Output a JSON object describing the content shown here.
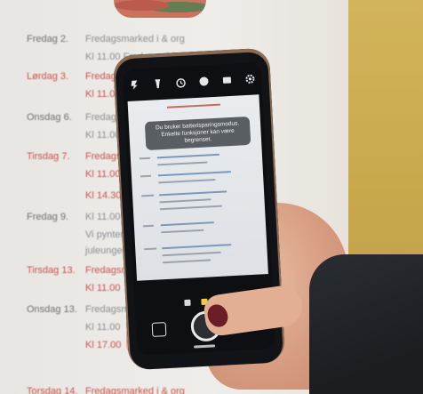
{
  "background_document": {
    "rows": [
      {
        "day": "Fredag 2.",
        "desc": "Fredagsmarked i & org",
        "red": false
      },
      {
        "day": "",
        "desc": "Kl 11.00 Fredagstakk",
        "red": false
      },
      {
        "day": "Lørdag 3.",
        "desc": "Fredagsmarked",
        "red": true
      },
      {
        "day": "",
        "desc": "Kl 11.00",
        "red": true
      },
      {
        "day": "Onsdag 6.",
        "desc": "Fredagsmarked",
        "red": false
      },
      {
        "day": "",
        "desc": "Kl 11.00",
        "red": false
      },
      {
        "day": "Tirsdag 7.",
        "desc": "Fredagsmarked",
        "red": true
      },
      {
        "day": "",
        "desc": "Kl 11.00",
        "red": true
      },
      {
        "day": "",
        "desc": "Kl 14.30",
        "red": true
      },
      {
        "day": "Fredag 9.",
        "desc": "Kl 11.00",
        "red": false
      },
      {
        "day": "",
        "desc": "Vi pynter",
        "red": false
      },
      {
        "day": "",
        "desc": "juleungen",
        "red": false
      },
      {
        "day": "Tirsdag 13.",
        "desc": "Fredagsmarked",
        "red": true
      },
      {
        "day": "",
        "desc": "Kl 11.00",
        "red": true
      },
      {
        "day": "Onsdag 13.",
        "desc": "Fredagsmarked",
        "red": false
      },
      {
        "day": "",
        "desc": "Kl 11.00",
        "red": false
      },
      {
        "day": "",
        "desc": "Kl 17.00",
        "red": true
      },
      {
        "day": "Torsdag 14.",
        "desc": "Fredagsmarked i & org",
        "red": true
      }
    ]
  },
  "phone": {
    "toast": "Du bruker batterisparingsmodus. Enkelte funksjoner kan være begrenset.",
    "toolbar_icons": [
      "flash-off-icon",
      "flashlight-icon",
      "timer-icon",
      "hdr-icon",
      "aspect-ratio-icon",
      "settings-icon"
    ],
    "mode_indicators": [
      "inactive",
      "active",
      "inactive"
    ],
    "colors": {
      "active_mode": "#f1cc3a",
      "toast_bg": "#464a50"
    }
  }
}
